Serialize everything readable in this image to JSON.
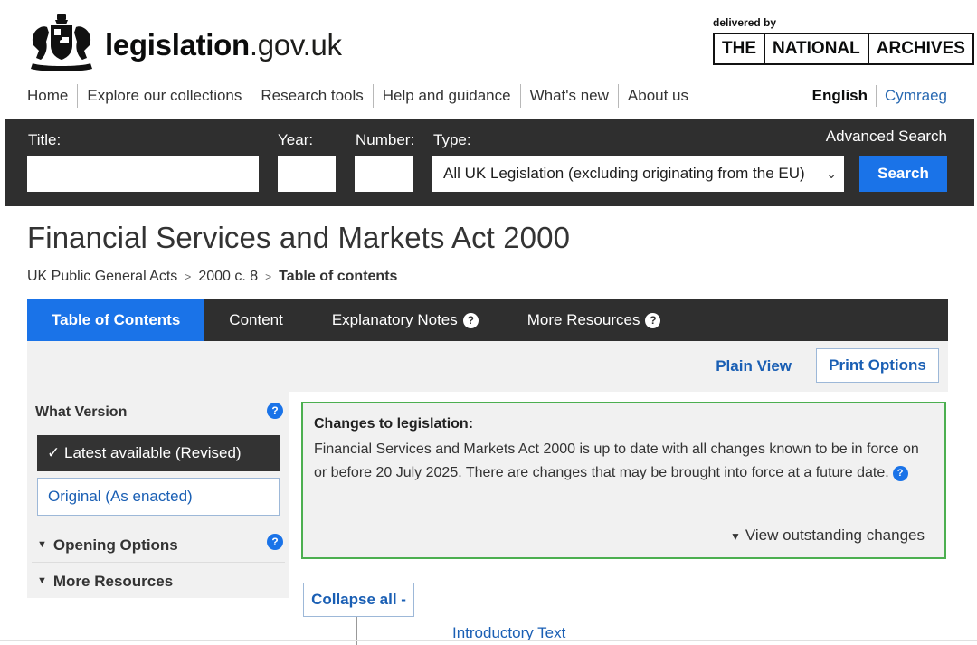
{
  "header": {
    "logo_bold": "legislation",
    "logo_rest": ".gov.uk",
    "delivered_by": "delivered by",
    "tna": [
      "THE",
      "NATIONAL",
      "ARCHIVES"
    ]
  },
  "nav": {
    "items": [
      "Home",
      "Explore our collections",
      "Research tools",
      "Help and guidance",
      "What's new",
      "About us"
    ],
    "lang_current": "English",
    "lang_alt": "Cymraeg"
  },
  "search": {
    "title_label": "Title:",
    "year_label": "Year:",
    "number_label": "Number:",
    "type_label": "Type:",
    "advanced": "Advanced Search",
    "title_value": "",
    "year_value": "",
    "number_value": "",
    "type_selected": "All UK Legislation (excluding originating from the EU)",
    "button": "Search"
  },
  "page": {
    "title": "Financial Services and Markets Act 2000",
    "breadcrumb": [
      "UK Public General Acts",
      "2000 c. 8",
      "Table of contents"
    ]
  },
  "tabs": [
    {
      "label": "Table of Contents",
      "active": true,
      "help": false
    },
    {
      "label": "Content",
      "active": false,
      "help": false
    },
    {
      "label": "Explanatory Notes",
      "active": false,
      "help": true
    },
    {
      "label": "More Resources",
      "active": false,
      "help": true
    }
  ],
  "toolbar": {
    "plain_view": "Plain View",
    "print_options": "Print Options"
  },
  "sidebar": {
    "heading": "What Version",
    "latest": "Latest available (Revised)",
    "original": "Original (As enacted)",
    "opening_options": "Opening Options",
    "more_resources": "More Resources",
    "help_glyph": "?"
  },
  "changes": {
    "heading": "Changes to legislation:",
    "body": "Financial Services and Markets Act 2000 is up to date with all changes known to be in force on or before 20 July 2025. There are changes that may be brought into force at a future date.",
    "outstanding": "View outstanding changes"
  },
  "contents": {
    "collapse": "Collapse all -",
    "intro": "Introductory Text"
  },
  "icons": {
    "crest": "royal-coat-of-arms-icon",
    "check": "✓",
    "triangle_down": "▼",
    "chevron_right": "›",
    "help": "?"
  },
  "colors": {
    "accent_blue": "#1a73e8",
    "link_blue": "#1a5fb4",
    "dark_bar": "#2f2f2f",
    "changes_border": "#4caf50"
  }
}
